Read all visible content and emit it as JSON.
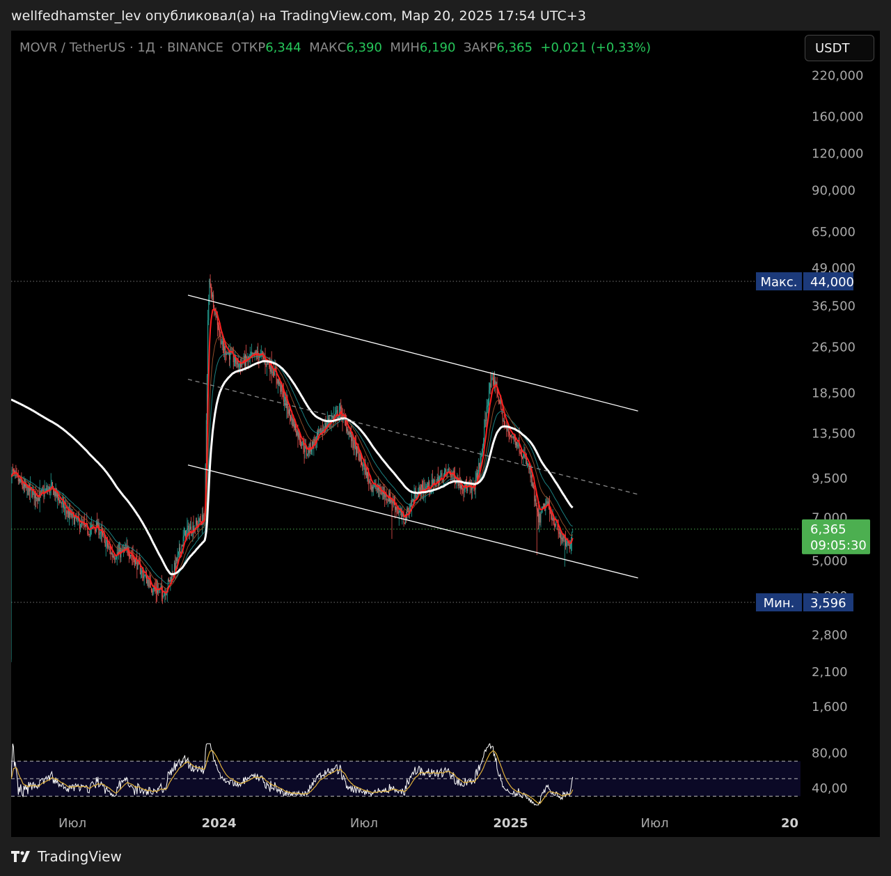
{
  "header": {
    "text": "wellfedhamster_lev опубликовал(а) на TradingView.com, Мар 20, 2025 17:54 UTC+3"
  },
  "legend": {
    "symbol": "MOVR / TetherUS · 1Д · BINANCE",
    "open_label": "ОТКР",
    "open": "6,344",
    "high_label": "МАКС",
    "high": "6,390",
    "low_label": "МИН",
    "low": "6,190",
    "close_label": "ЗАКР",
    "close": "6,365",
    "change": "+0,021 (+0,33%)"
  },
  "currency_button": "USDT",
  "price_scale": [
    "220,000",
    "160,000",
    "120,000",
    "90,000",
    "65,000",
    "49,000",
    "36,500",
    "26,500",
    "18,500",
    "13,500",
    "9,500",
    "7,000",
    "5,000",
    "3,800",
    "2,800",
    "2,100",
    "1,600"
  ],
  "rsi_scale": [
    "80,00",
    "40,00"
  ],
  "time_axis": [
    "Июл",
    "2024",
    "Июл",
    "2025",
    "Июл",
    "20"
  ],
  "markers": {
    "max_label": "Макс.",
    "max_value": "44,000",
    "min_label": "Мин.",
    "min_value": "3,596",
    "last_price": "6,365",
    "countdown": "09:05:30"
  },
  "footer": {
    "brand": "TradingView"
  },
  "colors": {
    "up": "#26a69a",
    "down": "#ef5350",
    "price_tag": "#4caf50",
    "marker": "#1c3a7a",
    "ema_fast": "#ff1f1f",
    "ma_slow": "#ffffff",
    "rsi": "#ffffff",
    "rsi_ma": "#e0b13a"
  },
  "chart_data": {
    "type": "candlestick",
    "scale": "log",
    "timeframe": "1D",
    "ylim": [
      1.4,
      240
    ],
    "x_range": [
      "2023-04-15",
      "2025-12-31"
    ],
    "ohlc_anchors": [
      {
        "date": "2023-04-15",
        "close": 10.0
      },
      {
        "date": "2023-05-01",
        "close": 8.8
      },
      {
        "date": "2023-05-20",
        "close": 8.2
      },
      {
        "date": "2023-06-05",
        "close": 8.8
      },
      {
        "date": "2023-06-25",
        "close": 7.2
      },
      {
        "date": "2023-07-20",
        "close": 6.3
      },
      {
        "date": "2023-08-01",
        "close": 6.5
      },
      {
        "date": "2023-08-20",
        "close": 5.2
      },
      {
        "date": "2023-09-10",
        "close": 5.4
      },
      {
        "date": "2023-09-25",
        "close": 4.6
      },
      {
        "date": "2023-10-10",
        "close": 4.0
      },
      {
        "date": "2023-10-25",
        "close": 3.9
      },
      {
        "date": "2023-11-05",
        "close": 4.6
      },
      {
        "date": "2023-11-20",
        "close": 6.2
      },
      {
        "date": "2023-12-05",
        "close": 6.6
      },
      {
        "date": "2023-12-14",
        "close": 7.0
      },
      {
        "date": "2023-12-18",
        "close": 32.0
      },
      {
        "date": "2023-12-20",
        "close": 44.0
      },
      {
        "date": "2024-01-05",
        "close": 26.5
      },
      {
        "date": "2024-01-25",
        "close": 23.0
      },
      {
        "date": "2024-02-20",
        "close": 25.0
      },
      {
        "date": "2024-03-10",
        "close": 22.0
      },
      {
        "date": "2024-04-01",
        "close": 15.0
      },
      {
        "date": "2024-04-20",
        "close": 11.5
      },
      {
        "date": "2024-05-15",
        "close": 14.5
      },
      {
        "date": "2024-06-01",
        "close": 16.0
      },
      {
        "date": "2024-06-20",
        "close": 12.0
      },
      {
        "date": "2024-07-10",
        "close": 9.0
      },
      {
        "date": "2024-08-05",
        "close": 8.0
      },
      {
        "date": "2024-08-20",
        "close": 6.8
      },
      {
        "date": "2024-09-05",
        "close": 8.5
      },
      {
        "date": "2024-09-25",
        "close": 9.0
      },
      {
        "date": "2024-10-15",
        "close": 10.0
      },
      {
        "date": "2024-11-01",
        "close": 9.0
      },
      {
        "date": "2024-11-15",
        "close": 8.6
      },
      {
        "date": "2024-11-25",
        "close": 11.0
      },
      {
        "date": "2024-12-05",
        "close": 19.0
      },
      {
        "date": "2024-12-12",
        "close": 20.5
      },
      {
        "date": "2024-12-25",
        "close": 14.0
      },
      {
        "date": "2025-01-10",
        "close": 12.5
      },
      {
        "date": "2025-01-25",
        "close": 10.0
      },
      {
        "date": "2025-02-05",
        "close": 6.8
      },
      {
        "date": "2025-02-15",
        "close": 7.8
      },
      {
        "date": "2025-03-05",
        "close": 6.0
      },
      {
        "date": "2025-03-15",
        "close": 5.5
      },
      {
        "date": "2025-03-20",
        "close": 6.365
      }
    ],
    "channel": {
      "upper": [
        {
          "date": "2023-11-23",
          "price": 39.5
        },
        {
          "date": "2025-06-10",
          "price": 16.0
        }
      ],
      "lower": [
        {
          "date": "2023-11-23",
          "price": 10.5
        },
        {
          "date": "2025-06-10",
          "price": 4.35
        }
      ],
      "midline": [
        {
          "date": "2023-11-23",
          "price": 20.5
        },
        {
          "date": "2025-06-10",
          "price": 8.35
        }
      ]
    },
    "levels": {
      "max": 44.0,
      "min": 3.596,
      "last": 6.365
    },
    "rsi": {
      "upper": 70,
      "mid": 50,
      "lower": 30,
      "ylim": [
        20,
        90
      ]
    }
  }
}
